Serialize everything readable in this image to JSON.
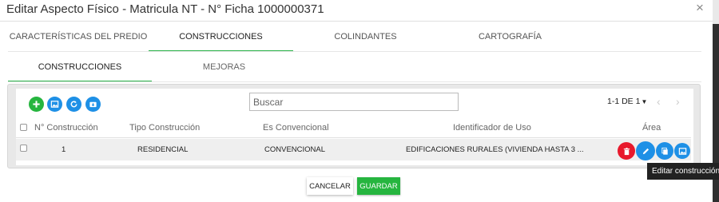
{
  "dialog": {
    "title": "Editar Aspecto Físico - Matricula NT - N° Ficha 1000000371",
    "close_symbol": "×"
  },
  "main_tabs": [
    {
      "label": "CARACTERÍSTICAS DEL PREDIO",
      "active": false
    },
    {
      "label": "CONSTRUCCIONES",
      "active": true
    },
    {
      "label": "COLINDANTES",
      "active": false
    },
    {
      "label": "CARTOGRAFÍA",
      "active": false
    }
  ],
  "sub_tabs": [
    {
      "label": "CONSTRUCCIONES",
      "active": true
    },
    {
      "label": "MEJORAS",
      "active": false
    }
  ],
  "toolbar": {
    "icons": [
      "add-icon",
      "image-icon",
      "refresh-icon",
      "download-icon"
    ],
    "search_placeholder": "Buscar",
    "pagination": "1-1 DE 1",
    "prev_icon": "‹",
    "next_icon": "›"
  },
  "table": {
    "columns": [
      "N° Construcción",
      "Tipo Construcción",
      "Es Convencional",
      "Identificador de Uso",
      "Área"
    ],
    "rows": [
      {
        "numero": "1",
        "tipo": "RESIDENCIAL",
        "convencional": "CONVENCIONAL",
        "uso": "EDIFICACIONES RURALES (VIVIENDA HASTA 3 ...",
        "actions": [
          "delete-icon",
          "edit-icon",
          "copy-icon",
          "image-icon"
        ]
      }
    ]
  },
  "tooltip": "Editar construcción",
  "footer": {
    "cancel_label": "CANCELAR",
    "save_label": "GUARDAR"
  },
  "colors": {
    "accent": "#26b53f",
    "blue": "#1e90e6",
    "red": "#e8192c"
  }
}
